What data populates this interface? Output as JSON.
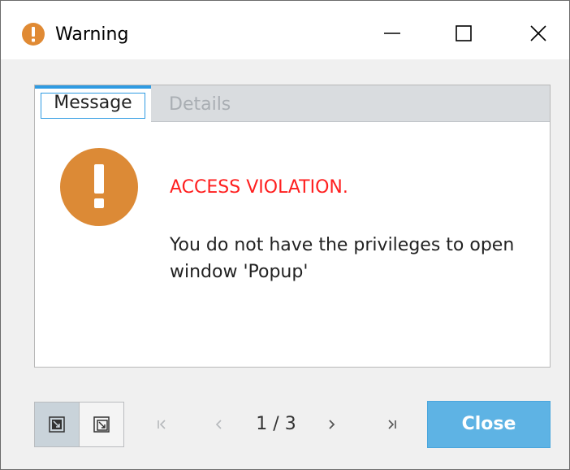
{
  "window": {
    "title": "Warning",
    "title_icon": "warning-circle-icon",
    "controls": [
      "minimize-icon",
      "maximize-icon",
      "close-icon"
    ]
  },
  "tabs": [
    {
      "label": "Message",
      "active": true
    },
    {
      "label": "Details",
      "active": false
    }
  ],
  "content": {
    "icon": "warning-circle-icon",
    "heading": "ACCESS VIOLATION.",
    "body_line1": "You do not have the privileges to open",
    "body_line2": "window 'Popup'"
  },
  "footer": {
    "pager": "1 / 3",
    "close_label": "Close",
    "nav_icons": [
      "first-page-icon",
      "previous-page-icon",
      "next-page-icon",
      "last-page-icon"
    ]
  },
  "colors": {
    "warning": "#dc8a36",
    "error_text": "#ff1f1f",
    "accent": "#2f9be2",
    "close_button": "#5eb3e4"
  }
}
